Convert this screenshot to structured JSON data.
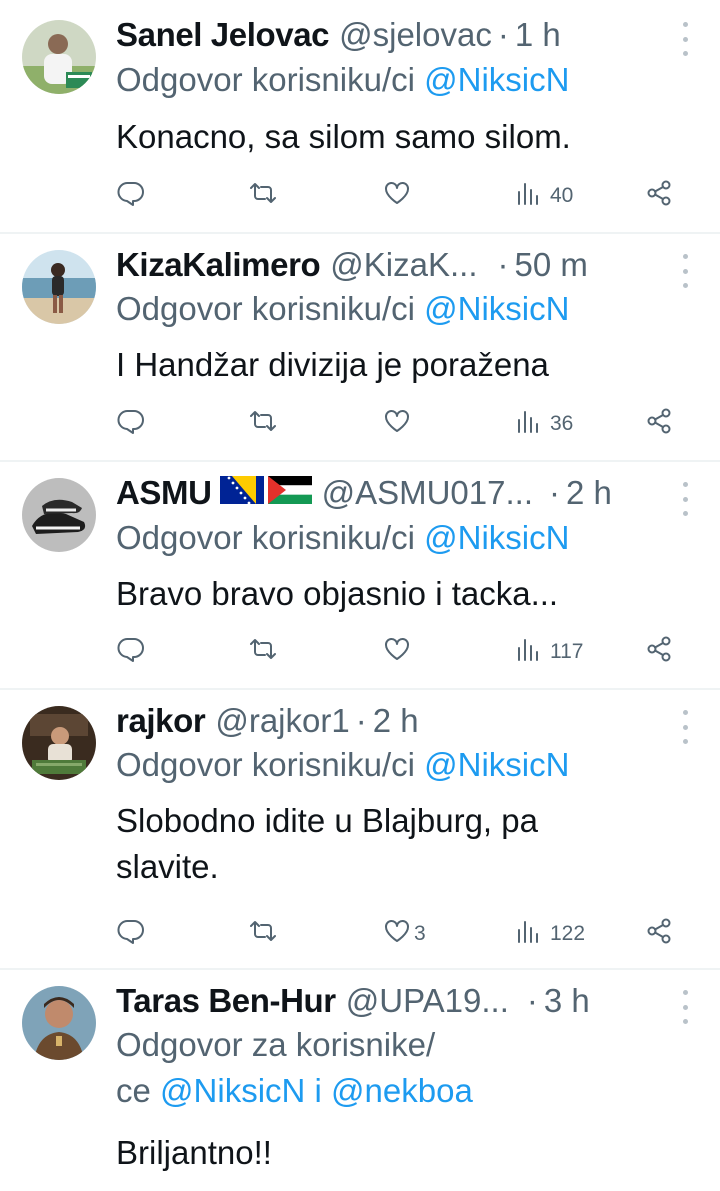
{
  "tweets": [
    {
      "name": "Sanel Jelovac",
      "handle": "@sjelovac",
      "time": "1 h",
      "reply_prefix": "Odgovor korisniku/ci",
      "reply_mentions": [
        "@NiksicN"
      ],
      "text_lines": [
        "Konacno, sa silom samo silom."
      ],
      "likes": "",
      "views": "40",
      "avatar": "man-on-grass"
    },
    {
      "name": "KizaKalimero",
      "handle": "@KizaK...",
      "time": "50 m",
      "reply_prefix": "Odgovor korisniku/ci",
      "reply_mentions": [
        "@NiksicN"
      ],
      "text_lines": [
        "I Handžar divizija je poražena"
      ],
      "likes": "",
      "views": "36",
      "avatar": "man-on-beach"
    },
    {
      "name": "ASMU",
      "handle": "@ASMU017...",
      "time": "2 h",
      "reply_prefix": "Odgovor korisniku/ci",
      "reply_mentions": [
        "@NiksicN"
      ],
      "text_lines": [
        "Bravo bravo objasnio i tacka..."
      ],
      "likes": "",
      "views": "117",
      "avatar": "sneakers",
      "flags": [
        "bosnia-flag",
        "palestine-flag"
      ]
    },
    {
      "name": "rajkor",
      "handle": "@rajkor1",
      "time": "2 h",
      "reply_prefix": "Odgovor korisniku/ci",
      "reply_mentions": [
        "@NiksicN"
      ],
      "text_lines": [
        "Slobodno idite u Blajburg, pa",
        "slavite."
      ],
      "likes": "3",
      "views": "122",
      "avatar": "man-with-cash"
    },
    {
      "name": "Taras Ben-Hur",
      "handle": "@UPA19...",
      "time": "3 h",
      "reply_prefix_lines": [
        "Odgovor za korisnike/",
        "ce"
      ],
      "reply_mentions": [
        "@NiksicN",
        "@nekboa"
      ],
      "reply_joiner": "i",
      "text_lines": [
        "Briljantno!!"
      ],
      "avatar": "actor-portrait"
    }
  ],
  "dot": "·",
  "icons": {
    "reply": "reply-icon",
    "retweet": "retweet-icon",
    "like": "heart-icon",
    "views": "views-icon",
    "share": "share-icon",
    "more": "more-icon"
  },
  "colors": {
    "link": "#1d9bf0",
    "secondary": "#536471",
    "text": "#0f1419",
    "divider": "#eff3f4"
  }
}
